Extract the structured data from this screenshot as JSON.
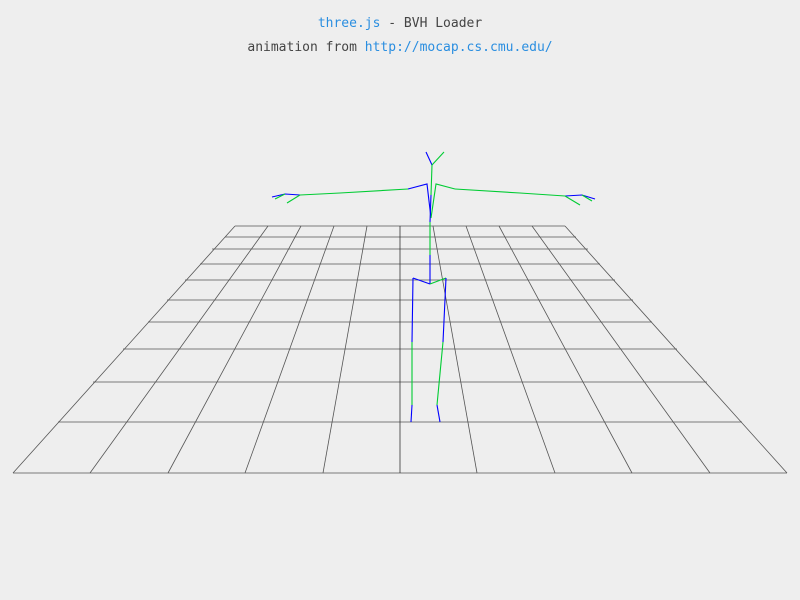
{
  "header": {
    "library_link": "three.js",
    "title_suffix": " - BVH Loader",
    "credit_prefix": "animation from ",
    "credit_link": "http://mocap.cs.cmu.edu/"
  },
  "scene": {
    "background_color": "#eeeeee",
    "grid_color": "#555555",
    "skeleton_colors": [
      "#0000ff",
      "#00ff00"
    ]
  }
}
